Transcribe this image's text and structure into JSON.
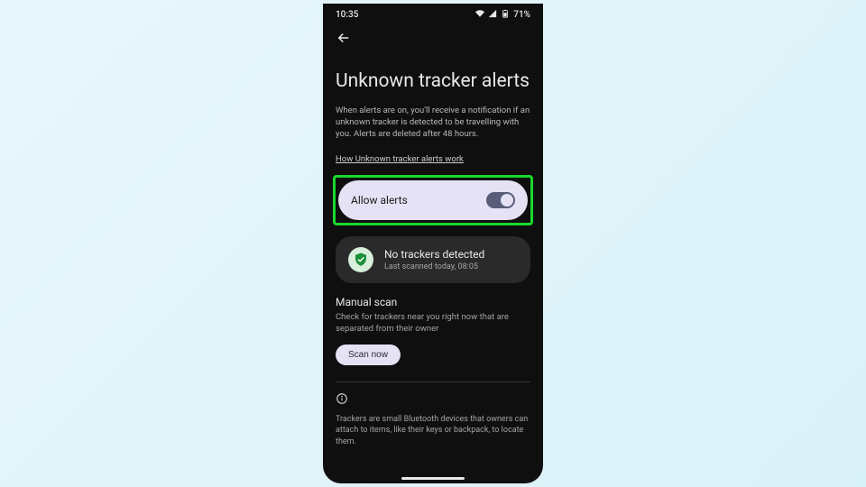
{
  "status_bar": {
    "time": "10:35",
    "battery": "71%"
  },
  "page": {
    "title": "Unknown tracker alerts",
    "description": "When alerts are on, you'll receive a notification if an unknown tracker is detected to be travelling with you. Alerts are deleted after 48 hours.",
    "link_text": "How Unknown tracker alerts work"
  },
  "toggle": {
    "label": "Allow alerts",
    "on": true
  },
  "status_card": {
    "title": "No trackers detected",
    "subtitle": "Last scanned today, 08:05"
  },
  "manual_scan": {
    "heading": "Manual scan",
    "description": "Check for trackers near you right now that are separated from their owner",
    "button": "Scan now"
  },
  "footer": {
    "text": "Trackers are small Bluetooth devices that owners can attach to items, like their keys or backpack, to locate them."
  }
}
